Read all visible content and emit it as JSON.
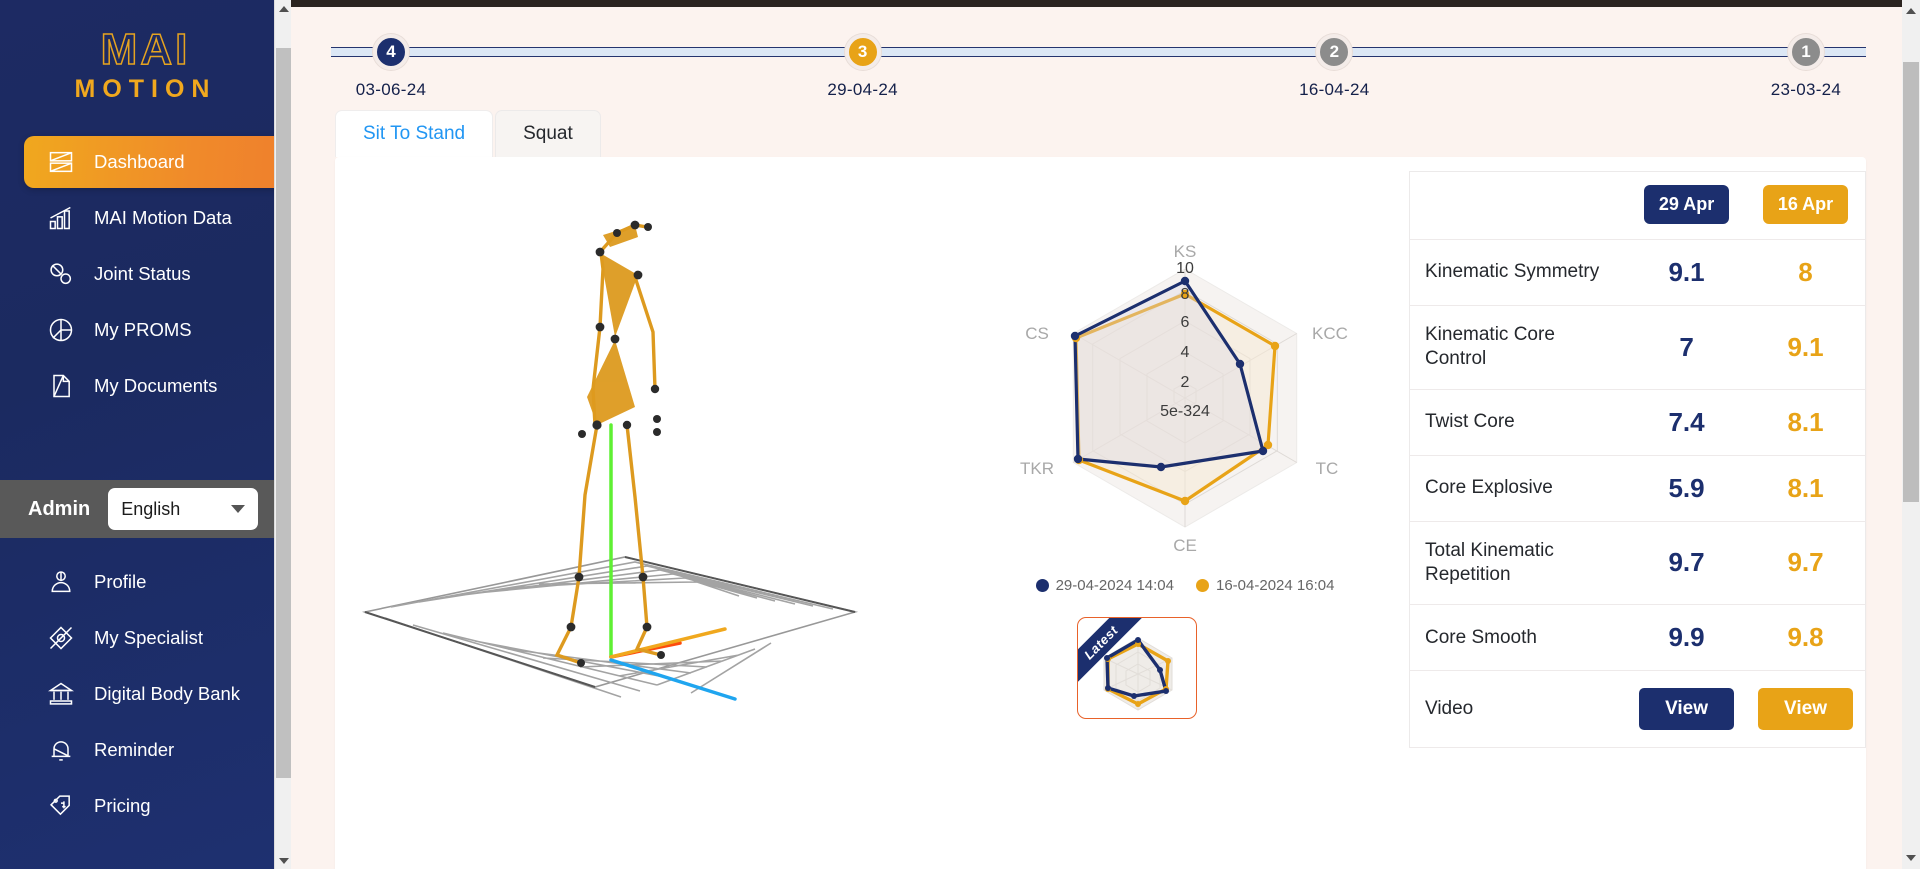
{
  "brand": {
    "line1": "MAI",
    "line2": "MOTION"
  },
  "sidebar": {
    "primary_items": [
      {
        "label": "Dashboard",
        "icon": "dashboard-icon",
        "active": true
      },
      {
        "label": "MAI Motion Data",
        "icon": "bar-chart-icon",
        "active": false
      },
      {
        "label": "Joint Status",
        "icon": "joints-icon",
        "active": false
      },
      {
        "label": "My PROMS",
        "icon": "pie-chart-icon",
        "active": false
      },
      {
        "label": "My Documents",
        "icon": "document-icon",
        "active": false
      }
    ],
    "account": {
      "role_label": "Admin",
      "language": "English"
    },
    "secondary_items": [
      {
        "label": "Profile",
        "icon": "user-icon"
      },
      {
        "label": "My Specialist",
        "icon": "specialist-icon"
      },
      {
        "label": "Digital Body Bank",
        "icon": "bank-icon"
      },
      {
        "label": "Reminder",
        "icon": "bell-icon"
      },
      {
        "label": "Pricing",
        "icon": "price-tag-icon"
      }
    ]
  },
  "stepper": {
    "steps": [
      {
        "number": "4",
        "date": "03-06-24",
        "state": "navy"
      },
      {
        "number": "3",
        "date": "29-04-24",
        "state": "gold"
      },
      {
        "number": "2",
        "date": "16-04-24",
        "state": "gray"
      },
      {
        "number": "1",
        "date": "23-03-24",
        "state": "gray"
      }
    ]
  },
  "tabs": [
    {
      "label": "Sit To Stand",
      "active": true
    },
    {
      "label": "Squat",
      "active": false
    }
  ],
  "comparison": {
    "col_a_label": "29 Apr",
    "col_b_label": "16 Apr",
    "col_a_color": "#1c2f6e",
    "col_b_color": "#e8a317",
    "rows": [
      {
        "metric": "Kinematic Symmetry",
        "a": "9.1",
        "b": "8"
      },
      {
        "metric": "Kinematic Core Control",
        "a": "7",
        "b": "9.1"
      },
      {
        "metric": "Twist Core",
        "a": "7.4",
        "b": "8.1"
      },
      {
        "metric": "Core Explosive",
        "a": "5.9",
        "b": "8.1"
      },
      {
        "metric": "Total Kinematic Repetition",
        "a": "9.7",
        "b": "9.7"
      },
      {
        "metric": "Core Smooth",
        "a": "9.9",
        "b": "9.8"
      }
    ],
    "video_row": {
      "metric": "Video",
      "a_button": "View",
      "b_button": "View"
    }
  },
  "thumbnail": {
    "ribbon_label": "Latest"
  },
  "chart_data": {
    "type": "radar",
    "title": "",
    "categories": [
      "KS",
      "KCC",
      "TC",
      "CE",
      "TKR",
      "CS"
    ],
    "tick_labels": [
      "5e-324",
      "2",
      "4",
      "6",
      "8",
      "10"
    ],
    "rmin": 0,
    "rmax": 10,
    "grid": true,
    "legend_position": "bottom",
    "series": [
      {
        "name": "29-04-2024 14:04",
        "color": "#1c2f6e",
        "values": [
          9.1,
          7,
          7.4,
          5.9,
          9.7,
          9.9
        ]
      },
      {
        "name": "16-04-2024 16:04",
        "color": "#e8a317",
        "values": [
          8,
          9.1,
          8.1,
          8.1,
          9.7,
          9.8
        ]
      }
    ]
  }
}
